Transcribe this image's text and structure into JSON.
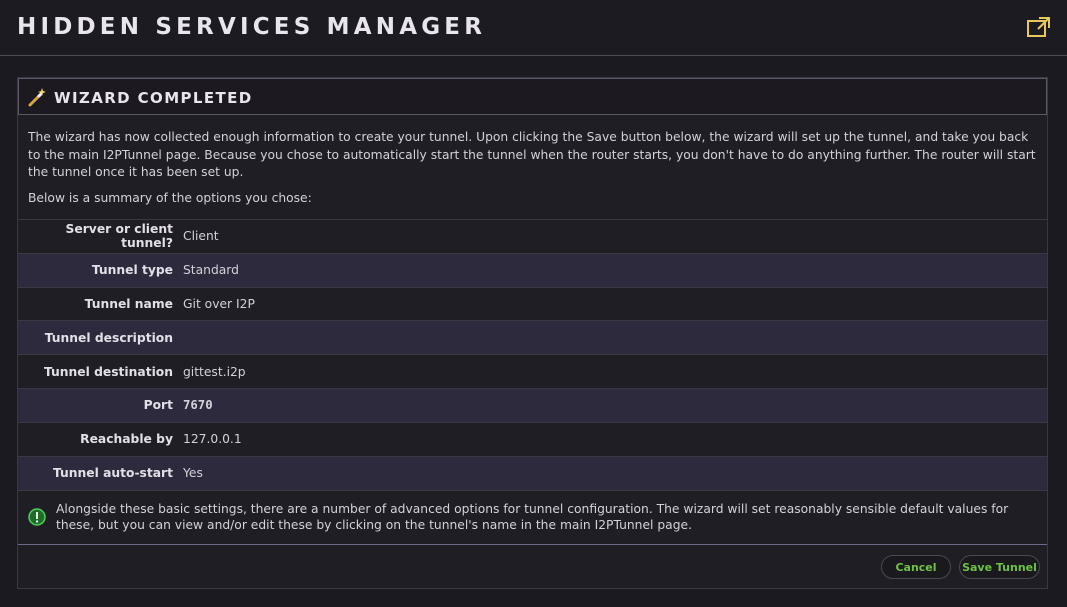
{
  "app": {
    "title": "HIDDEN SERVICES MANAGER",
    "popout_icon": "external-link-icon"
  },
  "panel": {
    "title": "WIZARD COMPLETED",
    "title_icon": "magic-wand-icon",
    "intro": "The wizard has now collected enough information to create your tunnel. Upon clicking the Save button below, the wizard will set up the tunnel, and take you back to the main I2PTunnel page. Because you chose to automatically start the tunnel when the router starts, you don't have to do anything further. The router will start the tunnel once it has been set up.",
    "summary_intro": "Below is a summary of the options you chose:",
    "summary": [
      {
        "label": "Server or client tunnel?",
        "value": "Client"
      },
      {
        "label": "Tunnel type",
        "value": "Standard"
      },
      {
        "label": "Tunnel name",
        "value": "Git over I2P"
      },
      {
        "label": "Tunnel description",
        "value": ""
      },
      {
        "label": "Tunnel destination",
        "value": "gittest.i2p"
      },
      {
        "label": "Port",
        "value": "7670"
      },
      {
        "label": "Reachable by",
        "value": "127.0.0.1"
      },
      {
        "label": "Tunnel auto-start",
        "value": "Yes"
      }
    ],
    "notice_icon": "info-exclamation-icon",
    "notice": "Alongside these basic settings, there are a number of advanced options for tunnel configuration. The wizard will set reasonably sensible default values for these, but you can view and/or edit these by clicking on the tunnel's name in the main I2PTunnel page."
  },
  "buttons": {
    "cancel": "Cancel",
    "save": "Save Tunnel"
  },
  "colors": {
    "accent_green": "#6dc243",
    "alt_row": "#2d2a3e",
    "background": "#1b1a20"
  }
}
